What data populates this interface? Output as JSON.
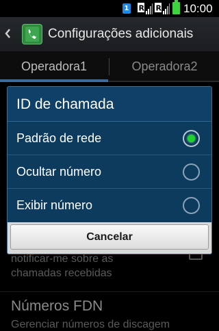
{
  "status_bar": {
    "sim_slot": "1",
    "sim1_label": "R",
    "sim2_label": "R",
    "time": "10:00",
    "battery_color": "#3fd43f"
  },
  "app_bar": {
    "back_icon": "chevron-left-icon",
    "app_icon": "phone-icon",
    "title": "Configurações adicionais"
  },
  "tabs": [
    {
      "label": "Operadora1",
      "selected": true
    },
    {
      "label": "Operadora2",
      "selected": false
    }
  ],
  "background_list": {
    "item_subtitle": "notificar-me sobre as\nchamadas recebidas",
    "next_title": "Números FDN",
    "next_subtitle": "Gerenciar números de discagem"
  },
  "dialog": {
    "title": "ID de chamada",
    "options": [
      {
        "label": "Padrão de rede",
        "selected": true
      },
      {
        "label": "Ocultar número",
        "selected": false
      },
      {
        "label": "Exibir número",
        "selected": false
      }
    ],
    "cancel_label": "Cancelar",
    "accent_color": "#1fd12f",
    "background_color": "#0d3b5e"
  }
}
